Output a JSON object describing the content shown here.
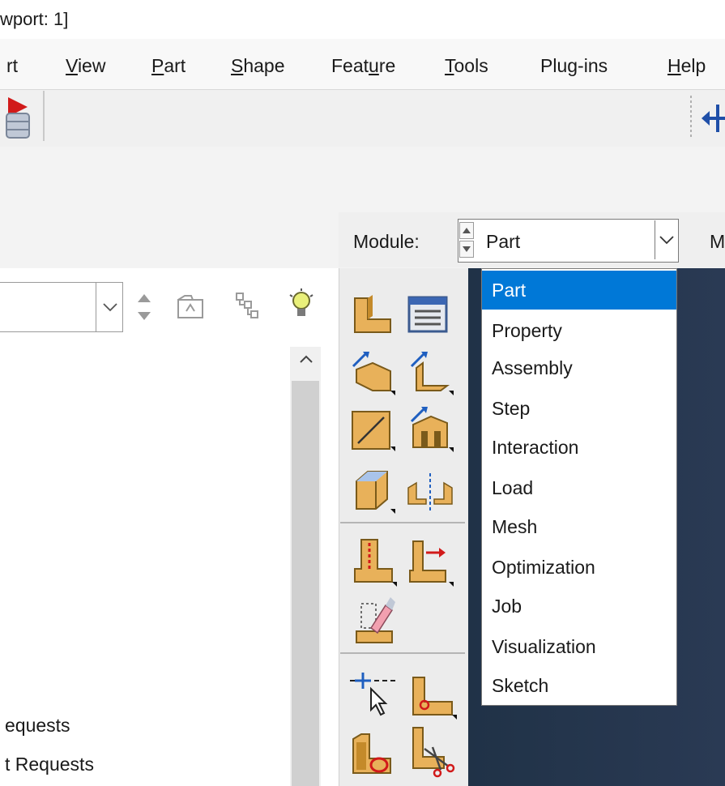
{
  "window": {
    "title_fragment": "wport: 1]"
  },
  "menu": {
    "items": [
      {
        "name": "menu-port",
        "label": "rt"
      },
      {
        "name": "menu-view",
        "label": "View",
        "mn": "V"
      },
      {
        "name": "menu-part",
        "label": "Part",
        "mn": "P"
      },
      {
        "name": "menu-shape",
        "label": "Shape",
        "mn": "S"
      },
      {
        "name": "menu-feature",
        "label": "Feature",
        "mn": "u"
      },
      {
        "name": "menu-tools",
        "label": "Tools",
        "mn": "T"
      },
      {
        "name": "menu-plugins",
        "label": "Plug-ins",
        "mn": "g"
      },
      {
        "name": "menu-help",
        "label": "Help",
        "mn": "H"
      }
    ]
  },
  "module": {
    "label": "Module:",
    "selected": "Part",
    "next_label_fragment": "M",
    "options": [
      "Part",
      "Property",
      "Assembly",
      "Step",
      "Interaction",
      "Load",
      "Mesh",
      "Optimization",
      "Job",
      "Visualization",
      "Sketch"
    ]
  },
  "tree": {
    "items": [
      "equests",
      "t Requests"
    ]
  },
  "colors": {
    "accent": "#0078d7",
    "viewport": "#23344b"
  }
}
